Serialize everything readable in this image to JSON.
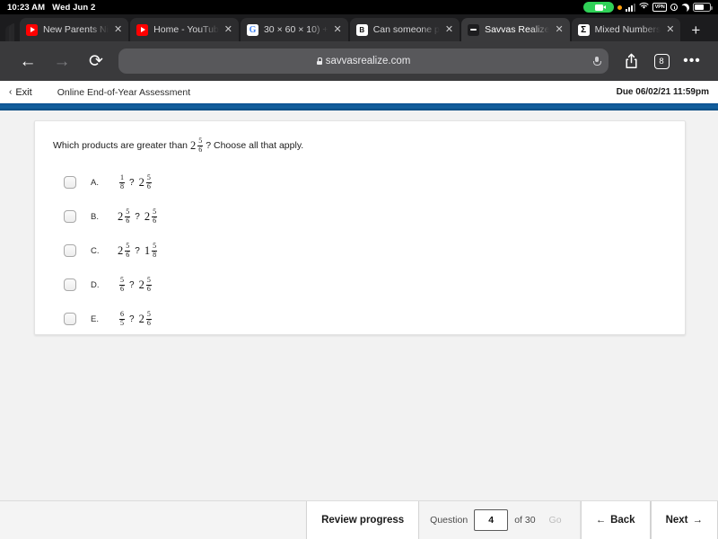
{
  "status_bar": {
    "time": "10:23 AM",
    "date": "Wed Jun 2",
    "icons": [
      "screen-recording-pill",
      "orange-privacy-dot",
      "cellular-bars",
      "wifi-icon",
      "vpn-badge",
      "lock-rotation-icon",
      "do-not-disturb-moon",
      "battery-icon"
    ],
    "vpn_label": "VPN"
  },
  "browser": {
    "tabs": [
      {
        "title": "New Parents Ni",
        "favicon": "youtube-icon",
        "active": false,
        "close_label": "✕"
      },
      {
        "title": "Home - YouTub",
        "favicon": "youtube-icon",
        "active": false,
        "close_label": "✕"
      },
      {
        "title": "30 × 60 × 10) +",
        "favicon": "google-icon",
        "favicon_glyph": "G",
        "active": false,
        "close_label": "✕"
      },
      {
        "title": "Can someone p",
        "favicon": "brainly-icon",
        "favicon_glyph": "B",
        "active": false,
        "close_label": "✕"
      },
      {
        "title": "Savvas Realize",
        "favicon": "savvas-icon",
        "active": true,
        "close_label": "✕"
      },
      {
        "title": "Mixed Numbers",
        "favicon": "sigma-icon",
        "favicon_glyph": "Σ",
        "active": false,
        "close_label": "✕"
      }
    ],
    "new_tab_label": "+",
    "back_label": "←",
    "forward_label": "→",
    "reload_label": "⟳",
    "url": "savvasrealize.com",
    "share_label": "↑",
    "tab_count": "8",
    "more_label": "•••"
  },
  "app_header": {
    "exit_label": "Exit",
    "exit_chevron": "‹",
    "title": "Online End-of-Year Assessment",
    "due": "Due 06/02/21 11:59pm",
    "accent_color": "#0f5c9e"
  },
  "question": {
    "prompt_before": "Which products are greater than",
    "prompt_value": {
      "whole": "2",
      "num": "5",
      "den": "6"
    },
    "prompt_after": "? Choose all that apply.",
    "options": [
      {
        "label": "A.",
        "left": {
          "whole": "",
          "num": "1",
          "den": "8"
        },
        "operator": "?",
        "right": {
          "whole": "2",
          "num": "5",
          "den": "6"
        },
        "checked": false
      },
      {
        "label": "B.",
        "left": {
          "whole": "2",
          "num": "5",
          "den": "6"
        },
        "operator": "?",
        "right": {
          "whole": "2",
          "num": "5",
          "den": "6"
        },
        "checked": false
      },
      {
        "label": "C.",
        "left": {
          "whole": "2",
          "num": "5",
          "den": "6"
        },
        "operator": "?",
        "right": {
          "whole": "1",
          "num": "5",
          "den": "8"
        },
        "checked": false
      },
      {
        "label": "D.",
        "left": {
          "whole": "",
          "num": "5",
          "den": "6"
        },
        "operator": "?",
        "right": {
          "whole": "2",
          "num": "5",
          "den": "6"
        },
        "checked": false
      },
      {
        "label": "E.",
        "left": {
          "whole": "",
          "num": "6",
          "den": "5"
        },
        "operator": "?",
        "right": {
          "whole": "2",
          "num": "5",
          "den": "6"
        },
        "checked": false
      }
    ]
  },
  "bottom_bar": {
    "review_progress_label": "Review progress",
    "question_word": "Question",
    "question_number": "4",
    "of_label": "of 30",
    "go_label": "Go",
    "back_label": "Back",
    "back_arrow": "←",
    "next_label": "Next",
    "next_arrow": "→"
  }
}
